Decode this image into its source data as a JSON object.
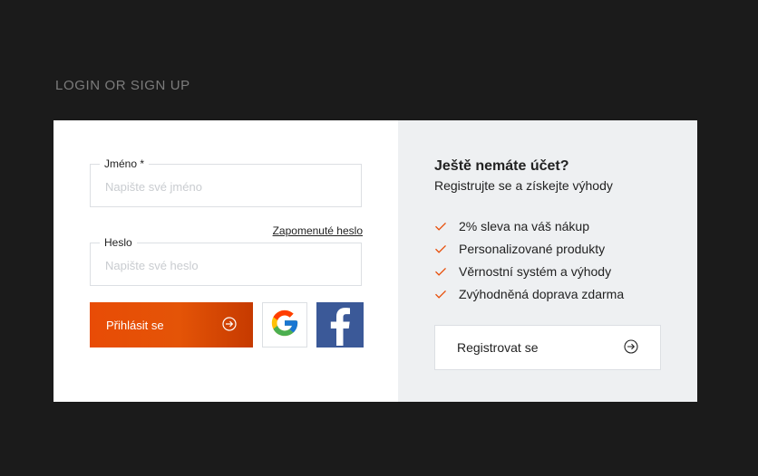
{
  "section_title": "LOGIN OR SIGN UP",
  "login": {
    "name_label": "Jméno *",
    "name_placeholder": "Napište své jméno",
    "password_label": "Heslo",
    "password_placeholder": "Napište své heslo",
    "forgot_link": "Zapomenuté heslo",
    "submit_label": "Přihlásit se",
    "social": [
      "google-icon",
      "facebook-icon"
    ]
  },
  "register": {
    "title": "Ještě nemáte účet?",
    "subtitle": "Registrujte se a získejte výhody",
    "benefits": [
      "2% sleva na váš nákup",
      "Personalizované produkty",
      "Věrnostní systém a výhody",
      "Zvýhodněná doprava zdarma"
    ],
    "button_label": "Registrovat se"
  },
  "colors": {
    "accent": "#e84c06",
    "page_bg": "#1b1b1b",
    "panel_bg": "#eef0f2",
    "facebook": "#3b5998"
  }
}
